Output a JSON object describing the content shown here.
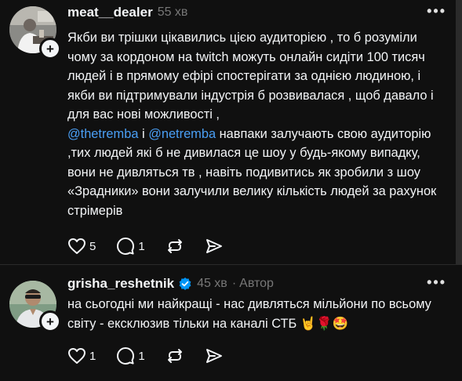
{
  "posts": [
    {
      "username": "meat__dealer",
      "time": "55 хв",
      "text_part1": "Якби ви трішки цікавились цією аудиторією , то б розуміли чому за кордоном на twitch можуть онлайн сидіти 100 тисяч людей і в прямому ефірі спостерігати за однією людиною, і якби ви підтримували індустрія б розвивалася , щоб давало і для вас нові можливості ,\n",
      "mention1": "@thetremba",
      "text_between": " і ",
      "mention2": "@netremba",
      "text_part2": " навпаки залучають свою аудиторію ,тих людей які б не дивилася це шоу у будь-якому випадку, вони не дивляться тв , навіть подивитись як зробили з шоу «Зрадники» вони залучили велику кількість людей за рахунок стрімерів",
      "likes": "5",
      "replies": "1"
    },
    {
      "username": "grisha_reshetnik",
      "time": "45 хв",
      "author_tag": "Автор",
      "text": "на сьогодні ми найкращі - нас дивляться мільйони по всьому світу - ексклюзив тільки на каналі СТБ 🤘🌹🤩",
      "likes": "1",
      "replies": "1"
    }
  ],
  "icons": {
    "more": "more-icon",
    "like": "heart-icon",
    "reply": "comment-icon",
    "repost": "repost-icon",
    "share": "send-icon",
    "follow": "plus-icon",
    "verified": "verified-badge-icon"
  },
  "colors": {
    "background": "#101010",
    "text": "#f3f5f7",
    "muted": "#777777",
    "mention": "#4a9ff5",
    "verified": "#0095f6"
  }
}
